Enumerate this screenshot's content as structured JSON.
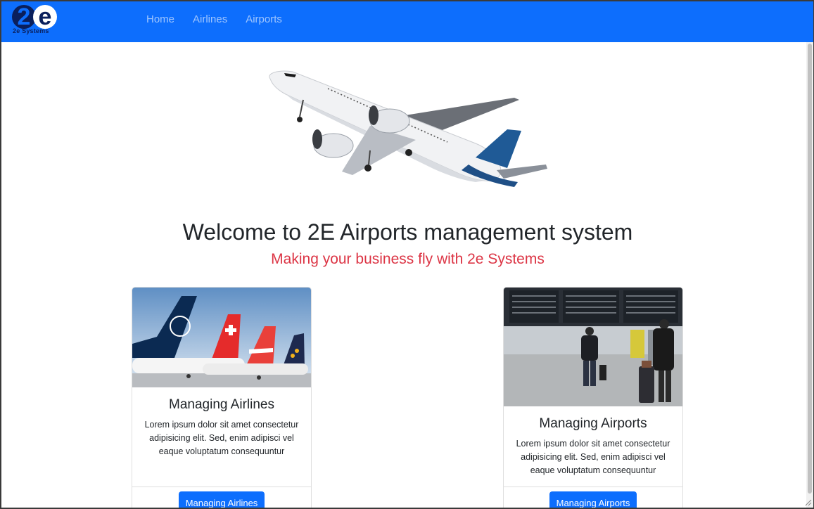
{
  "brand": {
    "logo_text": "2e Systems",
    "primary": "#0d6efd"
  },
  "nav": {
    "items": [
      {
        "label": "Home"
      },
      {
        "label": "Airlines"
      },
      {
        "label": "Airports"
      }
    ]
  },
  "hero": {
    "title": "Welcome to 2E Airports management system",
    "subtitle": "Making your business fly with 2e Systems",
    "subtitle_color": "#dc3545"
  },
  "cards": [
    {
      "title": "Managing Airlines",
      "text": "Lorem ipsum dolor sit amet consectetur adipisicing elit. Sed, enim adipisci vel eaque voluptatum consequuntur",
      "button": "Managing Airlines"
    },
    {
      "title": "Managing Airports",
      "text": "Lorem ipsum dolor sit amet consectetur adipisicing elit. Sed, enim adipisci vel eaque voluptatum consequuntur",
      "button": "Managing Airports"
    }
  ]
}
